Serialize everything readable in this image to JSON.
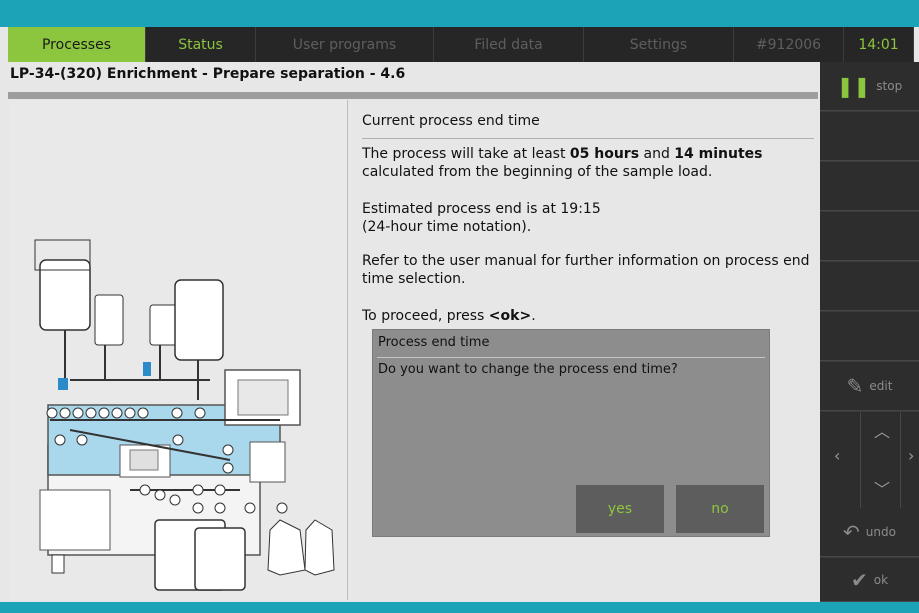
{
  "tabs": {
    "processes": "Processes",
    "status": "Status",
    "user_programs": "User programs",
    "filed_data": "Filed data",
    "settings": "Settings",
    "device_id": "#912006",
    "clock": "14:01"
  },
  "page_title": "LP-34-(320) Enrichment - Prepare separation - 4.6",
  "content": {
    "heading": "Current process end time",
    "p1_a": "The process will take at least ",
    "p1_hours": "05 hours",
    "p1_and": " and ",
    "p1_minutes": "14 minutes",
    "p1_b": " calculated from the beginning of the sample load.",
    "p2_a": "Estimated process end is at 19:15",
    "p2_b": "(24-hour time notation).",
    "p3": "Refer to the user manual for further information on process end time selection.",
    "p4_a": "To proceed, press ",
    "p4_ok": "<ok>",
    "p4_b": "."
  },
  "dialog": {
    "title": "Process end time",
    "message": "Do you want to change the process end time?",
    "yes": "yes",
    "no": "no"
  },
  "sidebar": {
    "stop": "stop",
    "edit": "edit",
    "undo": "undo",
    "ok": "ok"
  },
  "colors": {
    "accent_green": "#8cc63e",
    "top_bar_teal": "#1da3b8",
    "tab_dark": "#262626"
  },
  "icons": [
    "pause-icon",
    "edit-icon",
    "arrow-up-icon",
    "arrow-down-icon",
    "arrow-left-icon",
    "arrow-right-icon",
    "undo-icon",
    "check-icon"
  ]
}
